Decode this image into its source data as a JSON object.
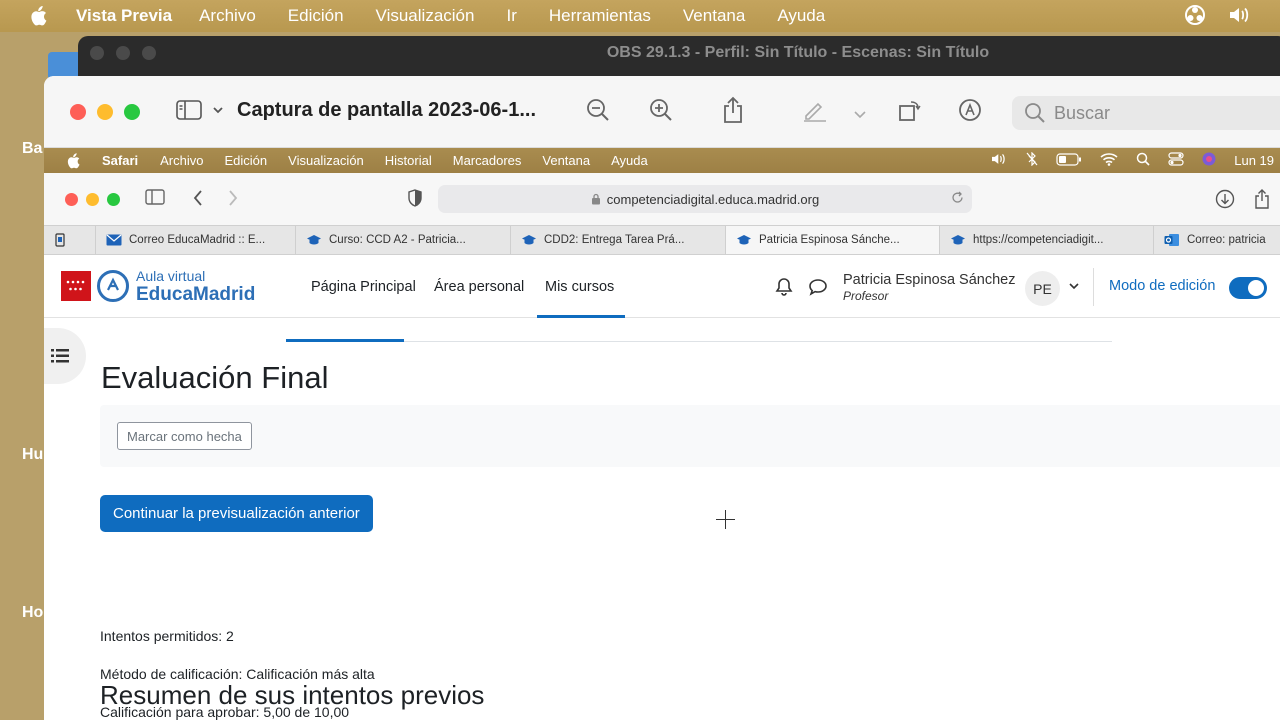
{
  "outer_menubar": {
    "app": "Vista Previa",
    "items": [
      "Archivo",
      "Edición",
      "Visualización",
      "Ir",
      "Herramientas",
      "Ventana",
      "Ayuda"
    ]
  },
  "desktop_labels": [
    "Ba",
    "Hu",
    "Ho"
  ],
  "obs": {
    "title": "OBS 29.1.3 - Perfil: Sin Título - Escenas: Sin Título"
  },
  "preview": {
    "title": "Captura de pantalla 2023-06-1...",
    "search_placeholder": "Buscar"
  },
  "inner_menubar": {
    "app": "Safari",
    "items": [
      "Archivo",
      "Edición",
      "Visualización",
      "Historial",
      "Marcadores",
      "Ventana",
      "Ayuda"
    ],
    "clock": "Lun 19"
  },
  "safari": {
    "url": "competenciadigital.educa.madrid.org",
    "tabs": [
      "Correo EducaMadrid :: E...",
      "Curso: CCD A2 - Patricia...",
      "CDD2: Entrega Tarea Prá...",
      "Patricia Espinosa Sánche...",
      "https://competenciadigit...",
      "Correo: patricia"
    ]
  },
  "moodle": {
    "logo_top": "Aula virtual",
    "logo_main": "EducaMadrid",
    "nav": [
      "Página Principal",
      "Área personal",
      "Mis cursos"
    ],
    "user_name": "Patricia Espinosa Sánchez",
    "user_role": "Profesor",
    "avatar": "PE",
    "edit_mode": "Modo de edición",
    "page_title": "Evaluación Final",
    "mark_done": "Marcar como hecha",
    "continue_btn": "Continuar la previsualización anterior",
    "attempts": "Intentos permitidos: 2",
    "grading_method": "Método de calificación: Calificación más alta",
    "pass_grade": "Calificación para aprobar: 5,00 de 10,00",
    "summary_title": "Resumen de sus intentos previos"
  },
  "colors": {
    "accent": "#0f6cbf",
    "educamadrid_blue": "#2d6fb6",
    "madrid_red": "#d0141a"
  }
}
